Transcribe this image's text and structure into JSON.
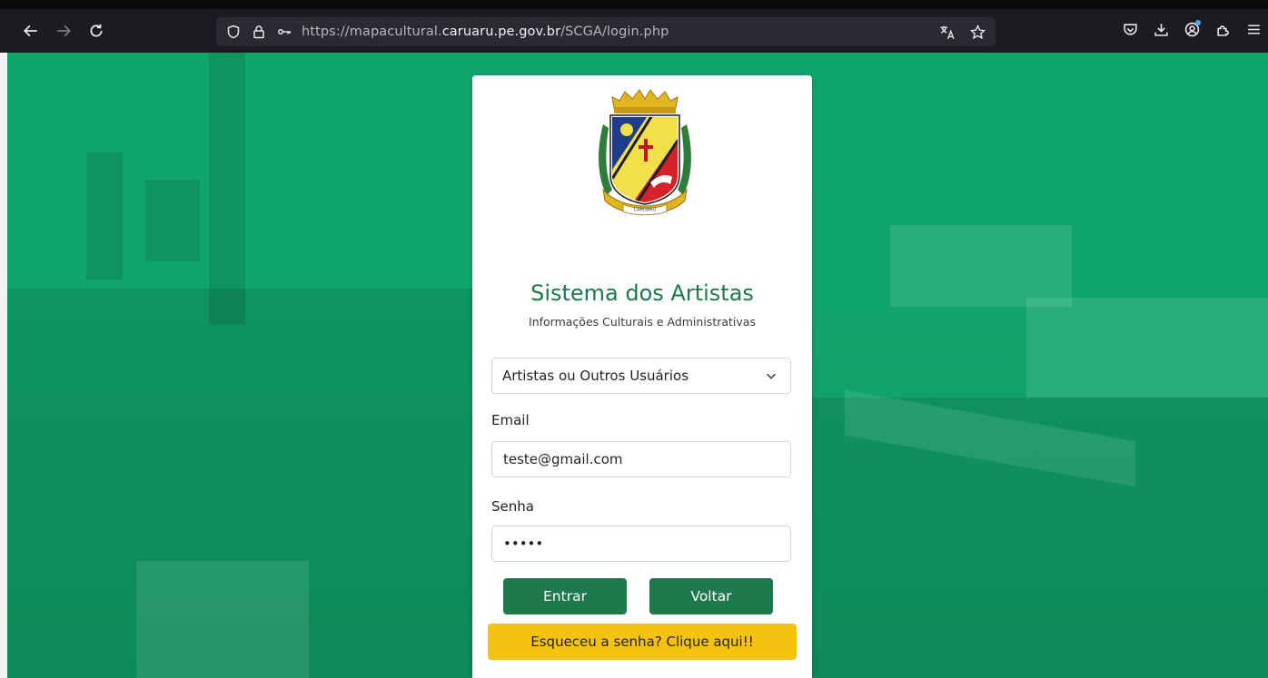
{
  "browser": {
    "url_prefix": "https://mapacultural.",
    "url_domain": "caruaru.pe.gov.br",
    "url_path": "/SCGA/login.php",
    "icons": {
      "back": "back-arrow-icon",
      "forward": "forward-arrow-icon",
      "reload": "reload-icon",
      "shield": "shield-icon",
      "lock": "lock-icon",
      "key": "key-icon",
      "translate": "translate-icon",
      "bookmark": "star-icon",
      "pocket": "pocket-icon",
      "download": "download-icon",
      "account": "account-icon",
      "extensions": "extensions-icon",
      "menu": "menu-icon"
    }
  },
  "login": {
    "crest_label": "CARUARU",
    "title": "Sistema dos Artistas",
    "subtitle": "Informações Culturais e Administrativas",
    "user_type_selected": "Artistas ou Outros Usuários",
    "email_label": "Email",
    "email_value": "teste@gmail.com",
    "password_label": "Senha",
    "password_value": "•••••",
    "enter_button": "Entrar",
    "back_button": "Voltar",
    "forgot_button": "Esqueceu a senha? Clique aqui!!"
  },
  "colors": {
    "brand_green": "#1e7a4d",
    "title_green": "#1b7a48",
    "background_green": "#0fa56d",
    "warning_yellow": "#f5c211"
  }
}
